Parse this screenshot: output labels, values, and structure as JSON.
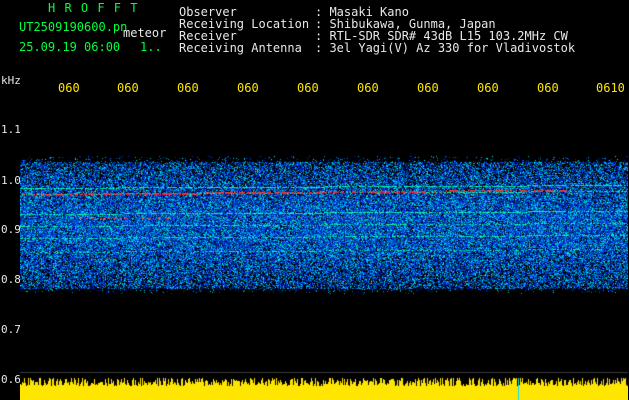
{
  "header": {
    "brand": "H R O F F T",
    "filename": "UT2509190600.pn",
    "mode": "meteor",
    "datetime": "25.09.19 06:00",
    "page": "1.."
  },
  "info": {
    "labels": [
      "Observer",
      "Receiving Location",
      "Receiver",
      "Receiving Antenna"
    ],
    "values": [
      ": Masaki Kano",
      ": Shibukawa, Gunma, Japan",
      ": RTL-SDR SDR# 43dB L15 103.2MHz CW",
      ": 3el Yagi(V) Az 330 for Vladivostok"
    ]
  },
  "xaxis": {
    "ticks": [
      "060",
      "060",
      "060",
      "060",
      "060",
      "060",
      "060",
      "060",
      "060",
      "0610"
    ]
  },
  "yaxis": {
    "unit": "kHz",
    "ticks": [
      "1.1",
      "1.0",
      "0.9",
      "0.8",
      "0.7",
      "0.6"
    ]
  },
  "colors": {
    "background": "#000000",
    "header_green": "#00ff3c",
    "text_white": "#e8e8e8",
    "tick_yellow": "#ffe600",
    "meteor_red": "#ff3030"
  }
}
